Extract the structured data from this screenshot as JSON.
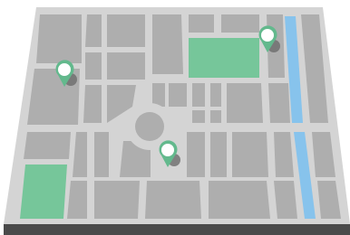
{
  "map": {
    "colors": {
      "background": "#ffffff",
      "street": "#d4d4d4",
      "block": "#aeaeae",
      "park": "#76c69a",
      "water": "#87c3ec",
      "pin_fill": "#ffffff",
      "pin_outline": "#63b98d",
      "pin_shadow": "#6b6b6b",
      "edge": "#4a4a4a"
    },
    "parks": 2,
    "river": true,
    "roundabout": true,
    "pins": [
      {
        "name": "map-pin-left",
        "icon": "location-pin-icon"
      },
      {
        "name": "map-pin-top-right",
        "icon": "location-pin-icon"
      },
      {
        "name": "map-pin-center",
        "icon": "location-pin-icon"
      }
    ]
  }
}
